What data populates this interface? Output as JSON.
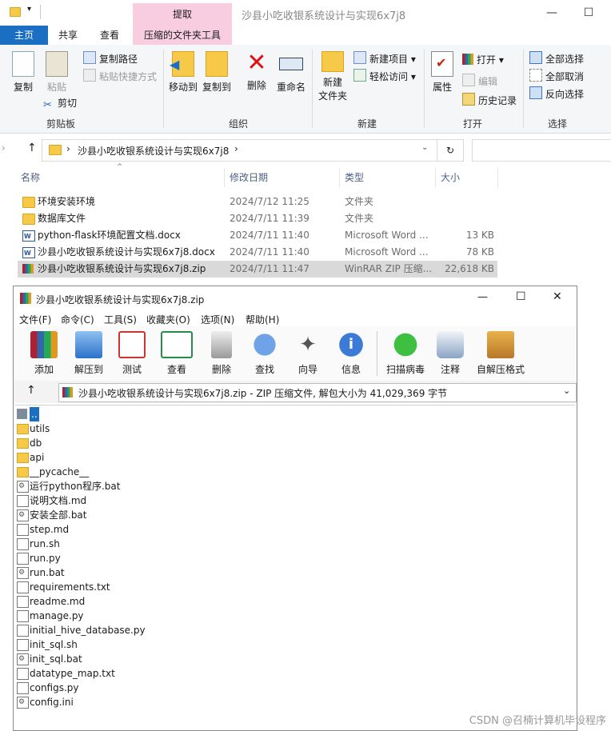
{
  "explorer": {
    "window_title": "沙县小吃收银系统设计与实现6x7j8",
    "context_tab_header": "提取",
    "tabs": [
      "主页",
      "共享",
      "查看",
      "压缩的文件夹工具"
    ],
    "ribbon": {
      "clipboard": {
        "copy": "复制",
        "paste": "粘贴",
        "copy_path": "复制路径",
        "paste_shortcut": "粘贴快捷方式",
        "cut": "剪切",
        "label": "剪贴板"
      },
      "organize": {
        "move_to": "移动到",
        "copy_to": "复制到",
        "delete": "删除",
        "rename": "重命名",
        "label": "组织"
      },
      "new": {
        "new_folder_l1": "新建",
        "new_folder_l2": "文件夹",
        "new_item": "新建项目",
        "easy_access": "轻松访问",
        "label": "新建"
      },
      "open": {
        "properties": "属性",
        "open": "打开",
        "edit": "编辑",
        "history": "历史记录",
        "label": "打开"
      },
      "select": {
        "select_all": "全部选择",
        "select_none": "全部取消",
        "invert": "反向选择",
        "label": "选择"
      }
    },
    "address": {
      "path": "沙县小吃收银系统设计与实现6x7j8"
    },
    "columns": {
      "name": "名称",
      "date": "修改日期",
      "type": "类型",
      "size": "大小"
    },
    "files": [
      {
        "name": "环境安装环境",
        "date": "2024/7/12 11:25",
        "type": "文件夹",
        "size": "",
        "icon": "folder"
      },
      {
        "name": "数据库文件",
        "date": "2024/7/11 11:39",
        "type": "文件夹",
        "size": "",
        "icon": "folder"
      },
      {
        "name": "python-flask环境配置文档.docx",
        "date": "2024/7/11 11:40",
        "type": "Microsoft Word ...",
        "size": "13 KB",
        "icon": "word"
      },
      {
        "name": "沙县小吃收银系统设计与实现6x7j8.docx",
        "date": "2024/7/11 11:40",
        "type": "Microsoft Word ...",
        "size": "78 KB",
        "icon": "word"
      },
      {
        "name": "沙县小吃收银系统设计与实现6x7j8.zip",
        "date": "2024/7/11 11:47",
        "type": "WinRAR ZIP 压缩...",
        "size": "22,618 KB",
        "icon": "rar"
      }
    ]
  },
  "rar": {
    "title": "沙县小吃收银系统设计与实现6x7j8.zip",
    "menu": [
      "文件(F)",
      "命令(C)",
      "工具(S)",
      "收藏夹(O)",
      "选项(N)",
      "帮助(H)"
    ],
    "toolbar": [
      "添加",
      "解压到",
      "测试",
      "查看",
      "删除",
      "查找",
      "向导",
      "信息",
      "扫描病毒",
      "注释",
      "自解压格式"
    ],
    "path_text": "沙县小吃收银系统设计与实现6x7j8.zip - ZIP 压缩文件, 解包大小为 41,029,369 字节",
    "items": [
      {
        "name": "..",
        "icon": "up"
      },
      {
        "name": "utils",
        "icon": "folder"
      },
      {
        "name": "db",
        "icon": "folder"
      },
      {
        "name": "api",
        "icon": "folder"
      },
      {
        "name": "__pycache__",
        "icon": "folder"
      },
      {
        "name": "运行python程序.bat",
        "icon": "bat"
      },
      {
        "name": "说明文档.md",
        "icon": "file"
      },
      {
        "name": "安装全部.bat",
        "icon": "bat"
      },
      {
        "name": "step.md",
        "icon": "file"
      },
      {
        "name": "run.sh",
        "icon": "file"
      },
      {
        "name": "run.py",
        "icon": "file"
      },
      {
        "name": "run.bat",
        "icon": "bat"
      },
      {
        "name": "requirements.txt",
        "icon": "file"
      },
      {
        "name": "readme.md",
        "icon": "file"
      },
      {
        "name": "manage.py",
        "icon": "file"
      },
      {
        "name": "initial_hive_database.py",
        "icon": "file"
      },
      {
        "name": "init_sql.sh",
        "icon": "file"
      },
      {
        "name": "init_sql.bat",
        "icon": "bat"
      },
      {
        "name": "datatype_map.txt",
        "icon": "file"
      },
      {
        "name": "configs.py",
        "icon": "file"
      },
      {
        "name": "config.ini",
        "icon": "bat"
      }
    ]
  },
  "watermark": "CSDN @召楠计算机毕设程序"
}
